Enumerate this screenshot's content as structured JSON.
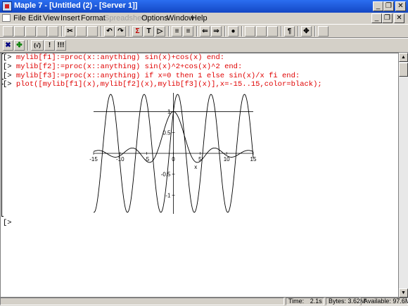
{
  "window": {
    "title": "Maple 7 - [Untitled (2) - [Server 1]]",
    "controls": [
      "_",
      "❐",
      "✕"
    ]
  },
  "menu": [
    "File",
    "Edit",
    "View",
    "Insert",
    "Format",
    "Spreadsheet",
    "Options",
    "Window",
    "Help"
  ],
  "document": {
    "prompt": "[>",
    "lines": [
      "mylib[f1]:=proc(x::anything) sin(x)+cos(x) end:",
      "mylib[f2]:=proc(x::anything) sin(x)^2+cos(x)^2 end:",
      "mylib[f3]:=proc(x::anything) if x=0 then 1 else sin(x)/x fi end:",
      "plot([mylib[f1](x),mylib[f2](x),mylib[f3](x)],x=-15..15,color=black);"
    ],
    "empty_prompt": "[>"
  },
  "chart_data": {
    "type": "line",
    "xlim": [
      -15,
      15
    ],
    "ylim": [
      -1.45,
      1.45
    ],
    "xlabel": "x",
    "ylabel": "",
    "x_ticks": [
      "-15",
      "-10",
      "-5",
      "0",
      "5",
      "10",
      "15"
    ],
    "y_ticks": [
      "1",
      "0.5",
      "-0.5",
      "-1"
    ],
    "grid": false,
    "series": [
      {
        "expr": "sin(x)+cos(x)",
        "color": "#000000"
      },
      {
        "expr": "sin(x)^2+cos(x)^2",
        "color": "#000000"
      },
      {
        "expr": "sin(x)/x",
        "color": "#000000"
      }
    ]
  },
  "status": {
    "time_label": "Time:",
    "time_value": "2.1s",
    "bytes_label": "Bytes:",
    "bytes_value": "3.62M",
    "available_label": "Available:",
    "available_value": "97.6M"
  }
}
